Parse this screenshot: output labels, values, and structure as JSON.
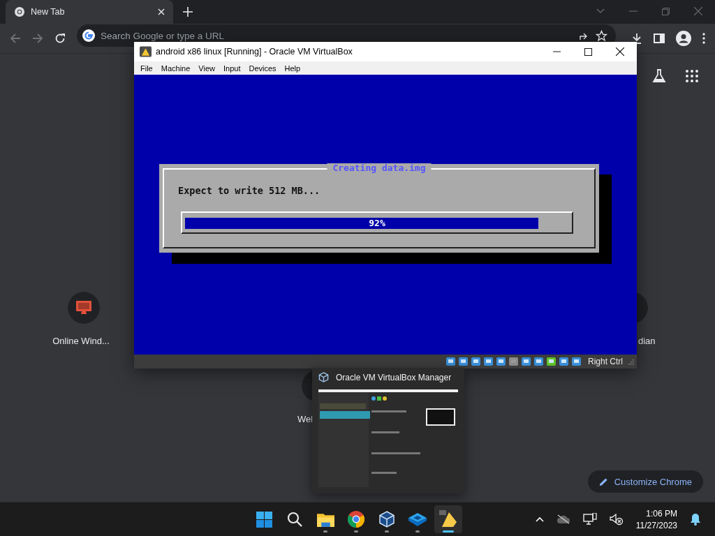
{
  "browser": {
    "tab": {
      "title": "New Tab"
    },
    "omnibox": {
      "placeholder": "Search Google or type a URL"
    },
    "shortcuts": [
      {
        "label": "Online Wind..."
      },
      {
        "label": "Wel"
      },
      {
        "label": "dian"
      }
    ],
    "customize_button": "Customize Chrome"
  },
  "vm_window": {
    "title": "android x86 linux [Running] - Oracle VM VirtualBox",
    "menu": [
      "File",
      "Machine",
      "View",
      "Input",
      "Devices",
      "Help"
    ],
    "dialog": {
      "title": "Creating data.img",
      "message": "Expect to write 512 MB...",
      "progress": {
        "level": 0.92,
        "reading": "92%"
      }
    },
    "status_bar": {
      "host_key": "Right Ctrl"
    }
  },
  "taskbar_preview": {
    "title": "Oracle VM VirtualBox Manager"
  },
  "taskbar": {
    "apps": [
      {
        "kind": "start",
        "running": false,
        "active": false
      },
      {
        "kind": "search",
        "running": false,
        "active": false
      },
      {
        "kind": "files",
        "running": true,
        "active": false
      },
      {
        "kind": "chrome",
        "running": true,
        "active": false
      },
      {
        "kind": "vbox",
        "running": true,
        "active": false
      },
      {
        "kind": "layers",
        "running": true,
        "active": false
      },
      {
        "kind": "android",
        "running": true,
        "active": true
      }
    ],
    "clock": {
      "time": "1:06 PM",
      "date": "11/27/2023"
    }
  }
}
